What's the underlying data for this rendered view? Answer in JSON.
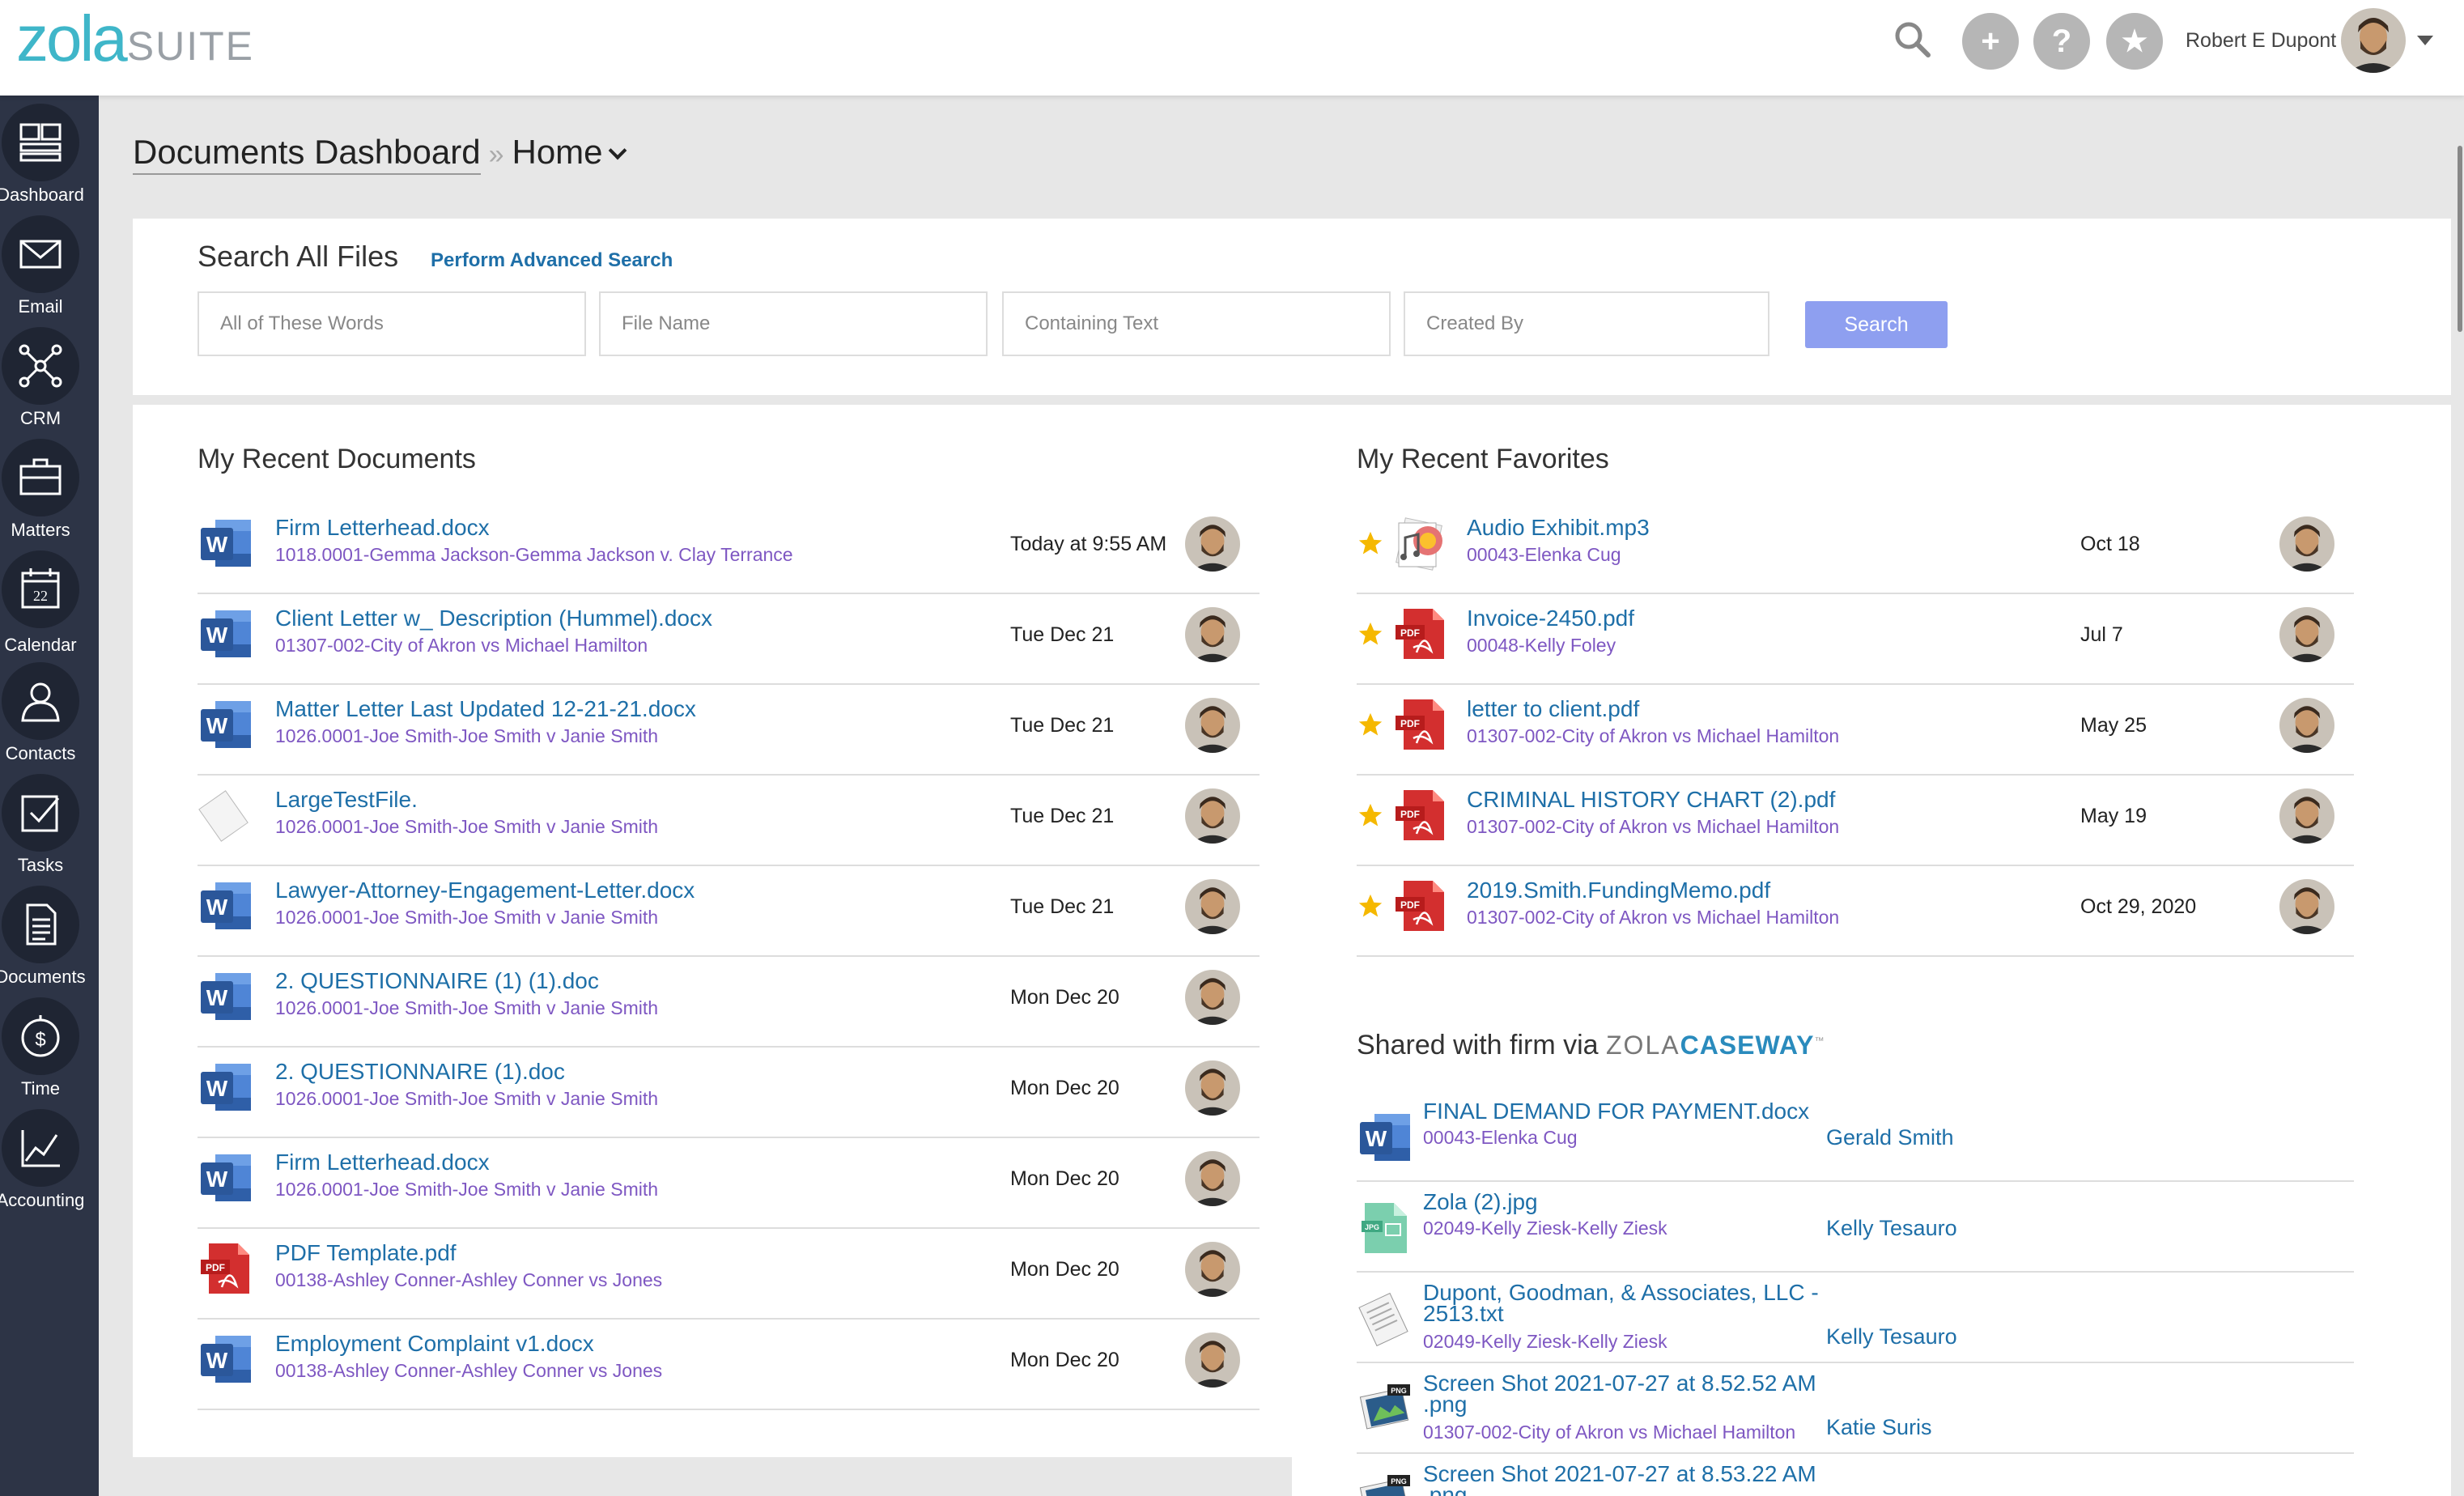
{
  "app": {
    "logo_zola": "zola",
    "logo_suite": "SUITE"
  },
  "header": {
    "user_name": "Robert E Dupont",
    "add_symbol": "+",
    "help_symbol": "?",
    "star_symbol": "★"
  },
  "sidebar": {
    "items": [
      {
        "label": "Dashboard",
        "icon": "dashboard-icon"
      },
      {
        "label": "Email",
        "icon": "email-icon"
      },
      {
        "label": "CRM",
        "icon": "crm-icon"
      },
      {
        "label": "Matters",
        "icon": "briefcase-icon"
      },
      {
        "label": "Calendar",
        "icon": "calendar-icon",
        "calendar_day": "22"
      },
      {
        "label": "Contacts",
        "icon": "contacts-icon"
      },
      {
        "label": "Tasks",
        "icon": "tasks-icon"
      },
      {
        "label": "Documents",
        "icon": "documents-icon"
      },
      {
        "label": "Time",
        "icon": "time-icon"
      },
      {
        "label": "Accounting",
        "icon": "accounting-icon"
      }
    ]
  },
  "breadcrumb": {
    "root": "Documents Dashboard",
    "separator": "»",
    "current": "Home"
  },
  "search": {
    "title": "Search All Files",
    "advanced_link": "Perform Advanced Search",
    "fields": [
      {
        "placeholder": "All of These Words"
      },
      {
        "placeholder": "File Name"
      },
      {
        "placeholder": "Containing Text"
      },
      {
        "placeholder": "Created By"
      }
    ],
    "button": "Search"
  },
  "recent_documents": {
    "title": "My Recent Documents",
    "rows": [
      {
        "name": "Firm Letterhead.docx",
        "matter": "1018.0001-Gemma Jackson-Gemma Jackson v. Clay Terrance",
        "date": "Today at 9:55 AM",
        "type": "word"
      },
      {
        "name": "Client Letter w_ Description (Hummel).docx",
        "matter": "01307-002-City of Akron vs Michael Hamilton",
        "date": "Tue Dec 21",
        "type": "word"
      },
      {
        "name": "Matter Letter Last Updated 12-21-21.docx",
        "matter": "1026.0001-Joe Smith-Joe Smith v Janie Smith",
        "date": "Tue Dec 21",
        "type": "word"
      },
      {
        "name": "LargeTestFile.",
        "matter": "1026.0001-Joe Smith-Joe Smith v Janie Smith",
        "date": "Tue Dec 21",
        "type": "generic"
      },
      {
        "name": "Lawyer-Attorney-Engagement-Letter.docx",
        "matter": "1026.0001-Joe Smith-Joe Smith v Janie Smith",
        "date": "Tue Dec 21",
        "type": "word"
      },
      {
        "name": "2. QUESTIONNAIRE (1) (1).doc",
        "matter": "1026.0001-Joe Smith-Joe Smith v Janie Smith",
        "date": "Mon Dec 20",
        "type": "word"
      },
      {
        "name": "2. QUESTIONNAIRE (1).doc",
        "matter": "1026.0001-Joe Smith-Joe Smith v Janie Smith",
        "date": "Mon Dec 20",
        "type": "word"
      },
      {
        "name": "Firm Letterhead.docx",
        "matter": "1026.0001-Joe Smith-Joe Smith v Janie Smith",
        "date": "Mon Dec 20",
        "type": "word"
      },
      {
        "name": "PDF Template.pdf",
        "matter": "00138-Ashley Conner-Ashley Conner vs Jones",
        "date": "Mon Dec 20",
        "type": "pdf"
      },
      {
        "name": "Employment Complaint v1.docx",
        "matter": "00138-Ashley Conner-Ashley Conner vs Jones",
        "date": "Mon Dec 20",
        "type": "word"
      }
    ]
  },
  "recent_favorites": {
    "title": "My Recent Favorites",
    "rows": [
      {
        "name": "Audio Exhibit.mp3",
        "matter": "00043-Elenka Cug",
        "date": "Oct 18",
        "type": "audio"
      },
      {
        "name": "Invoice-2450.pdf",
        "matter": "00048-Kelly Foley",
        "date": "Jul 7",
        "type": "pdf"
      },
      {
        "name": "letter to client.pdf",
        "matter": "01307-002-City of Akron vs Michael Hamilton",
        "date": "May 25",
        "type": "pdf"
      },
      {
        "name": "CRIMINAL HISTORY CHART (2).pdf",
        "matter": "01307-002-City of Akron vs Michael Hamilton",
        "date": "May 19",
        "type": "pdf"
      },
      {
        "name": "2019.Smith.FundingMemo.pdf",
        "matter": "01307-002-City of Akron vs Michael Hamilton",
        "date": "Oct 29, 2020",
        "type": "pdf"
      }
    ]
  },
  "shared": {
    "title": "Shared with firm via",
    "brand_a": "ZOLA",
    "brand_b": "CASEWAY",
    "trademark": "™",
    "rows": [
      {
        "name": "FINAL DEMAND FOR PAYMENT.docx",
        "name2": "",
        "matter": "00043-Elenka Cug",
        "shared_by": "Gerald Smith",
        "type": "word"
      },
      {
        "name": "Zola (2).jpg",
        "name2": "",
        "matter": "02049-Kelly Ziesk-Kelly Ziesk",
        "shared_by": "Kelly Tesauro",
        "type": "jpg"
      },
      {
        "name": "Dupont, Goodman, & Associates, LLC -",
        "name2": "2513.txt",
        "matter": "02049-Kelly Ziesk-Kelly Ziesk",
        "shared_by": "Kelly Tesauro",
        "type": "txt"
      },
      {
        "name": "Screen Shot 2021-07-27 at 8.52.52 AM",
        "name2": ".png",
        "matter": "01307-002-City of Akron vs Michael Hamilton",
        "shared_by": "Katie Suris",
        "type": "png"
      },
      {
        "name": "Screen Shot 2021-07-27 at 8.53.22 AM",
        "name2": ".png",
        "matter": "",
        "shared_by": "",
        "type": "png"
      }
    ]
  },
  "colors": {
    "sidebar_bg": "#2d3446",
    "link_blue": "#1e6fa8",
    "matter_purple": "#7e57c2",
    "search_button": "#8e9ff0",
    "word_blue": "#2b579a",
    "pdf_red": "#d32f2f",
    "star_gold": "#f5b800",
    "logo_teal": "#3fb6c9"
  }
}
